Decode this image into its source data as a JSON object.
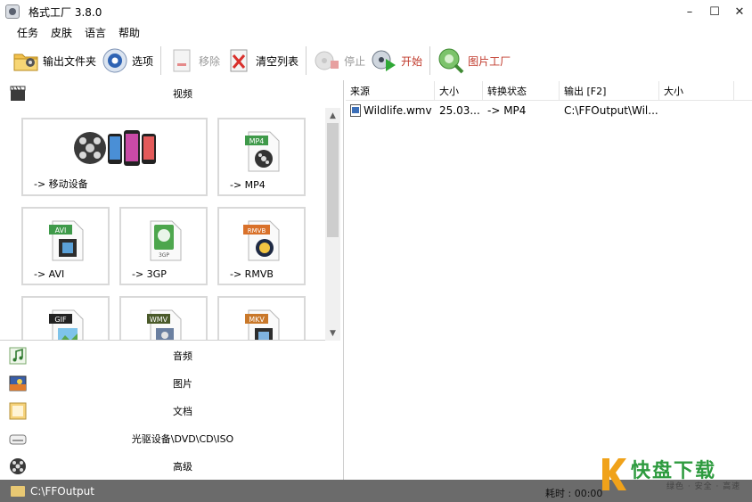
{
  "window": {
    "title": "格式工厂 3.8.0",
    "controls": {
      "minimize": "–",
      "maximize": "☐",
      "close": "✕"
    }
  },
  "menu": [
    "任务",
    "皮肤",
    "语言",
    "帮助"
  ],
  "toolbar": {
    "output_folder": "输出文件夹",
    "options": "选项",
    "remove": "移除",
    "clear_list": "清空列表",
    "stop": "停止",
    "start": "开始",
    "picture_factory": "图片工厂"
  },
  "left": {
    "video_header": "视频",
    "tiles": [
      {
        "label": "-> 移动设备",
        "icon": "mobile-devices-icon"
      },
      {
        "label": "-> MP4",
        "badge": "MP4",
        "icon": "mp4-file-icon"
      },
      {
        "label": "-> AVI",
        "badge": "AVI",
        "icon": "avi-file-icon"
      },
      {
        "label": "-> 3GP",
        "badge": "3GP",
        "icon": "3gp-file-icon"
      },
      {
        "label": "-> RMVB",
        "badge": "RMVB",
        "icon": "rmvb-file-icon"
      },
      {
        "label": "",
        "badge": "GIF",
        "icon": "gif-file-icon"
      },
      {
        "label": "",
        "badge": "WMV",
        "icon": "wmv-file-icon"
      },
      {
        "label": "",
        "badge": "MKV",
        "icon": "mkv-file-icon"
      }
    ],
    "categories": [
      {
        "label": "音频",
        "icon": "music-note-icon"
      },
      {
        "label": "图片",
        "icon": "picture-icon"
      },
      {
        "label": "文档",
        "icon": "document-icon"
      },
      {
        "label": "光驱设备\\DVD\\CD\\ISO",
        "icon": "optical-drive-icon"
      },
      {
        "label": "高级",
        "icon": "film-reel-icon"
      }
    ]
  },
  "list": {
    "headers": [
      "来源",
      "大小",
      "转换状态",
      "输出 [F2]",
      "大小"
    ],
    "rows": [
      {
        "source": "Wildlife.wmv",
        "size": "25.03...",
        "status": "-> MP4",
        "output": "C:\\FFOutput\\Wil...",
        "out_size": ""
      }
    ]
  },
  "status": {
    "path": "C:\\FFOutput",
    "elapsed": "耗时 : 00:00"
  },
  "watermark": {
    "title": "快盘下载",
    "subtitle": "绿色 · 安全 · 高速"
  }
}
